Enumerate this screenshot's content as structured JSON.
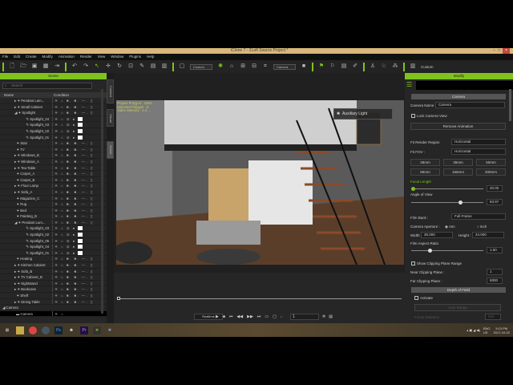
{
  "window": {
    "title": "iClone 7 - 2Loft Source Project *"
  },
  "menu": [
    "File",
    "Edit",
    "Create",
    "Modify",
    "Animation",
    "Render",
    "View",
    "Window",
    "Plugins",
    "Help"
  ],
  "toolbar": {
    "view_mode": "Custom",
    "camera": "Camera",
    "right_mode": "Custom"
  },
  "scene_panel": {
    "title": "Scene",
    "search_placeholder": "Search",
    "col_name": "Name",
    "col_condition": "Condition",
    "rows": [
      {
        "name": "Pendant Lam...",
        "indent": 2,
        "exp": "▸",
        "light": false
      },
      {
        "name": "Small Cabinet",
        "indent": 2,
        "exp": "▸",
        "light": false
      },
      {
        "name": "Spotlight",
        "indent": 2,
        "exp": "◢",
        "light": false
      },
      {
        "name": "Spotlight_04",
        "indent": 3,
        "exp": "",
        "light": true
      },
      {
        "name": "Spotlight_03",
        "indent": 3,
        "exp": "",
        "light": true
      },
      {
        "name": "Spotlight_02",
        "indent": 3,
        "exp": "",
        "light": true
      },
      {
        "name": "Spotlight_01",
        "indent": 3,
        "exp": "",
        "light": true
      },
      {
        "name": "Stair",
        "indent": 2,
        "exp": "",
        "light": false
      },
      {
        "name": "TV",
        "indent": 2,
        "exp": "",
        "light": false
      },
      {
        "name": "Windows_B",
        "indent": 2,
        "exp": "▸",
        "light": false
      },
      {
        "name": "Windows_A",
        "indent": 2,
        "exp": "▸",
        "light": false
      },
      {
        "name": "Tea Table",
        "indent": 2,
        "exp": "▸",
        "light": false
      },
      {
        "name": "Carpet_A",
        "indent": 2,
        "exp": "",
        "light": false
      },
      {
        "name": "Carpet_B",
        "indent": 2,
        "exp": "",
        "light": false
      },
      {
        "name": "Floor Lamp",
        "indent": 2,
        "exp": "▸",
        "light": false
      },
      {
        "name": "Sofa_A",
        "indent": 2,
        "exp": "▸",
        "light": false
      },
      {
        "name": "Magazine_C",
        "indent": 2,
        "exp": "",
        "light": false
      },
      {
        "name": "Rug",
        "indent": 2,
        "exp": "",
        "light": false
      },
      {
        "name": "Bed",
        "indent": 2,
        "exp": "",
        "light": false
      },
      {
        "name": "Painting_B",
        "indent": 2,
        "exp": "",
        "light": false
      },
      {
        "name": "Pendant Lum...",
        "indent": 2,
        "exp": "◢",
        "light": false
      },
      {
        "name": "Spotlight_03",
        "indent": 3,
        "exp": "",
        "light": true
      },
      {
        "name": "Spotlight_02",
        "indent": 3,
        "exp": "",
        "light": true
      },
      {
        "name": "Spotlight_05",
        "indent": 3,
        "exp": "",
        "light": true
      },
      {
        "name": "Spotlight_04",
        "indent": 3,
        "exp": "",
        "light": true
      },
      {
        "name": "Spotlight_01",
        "indent": 3,
        "exp": "",
        "light": true
      },
      {
        "name": "Heating",
        "indent": 2,
        "exp": "",
        "light": false
      },
      {
        "name": "Kitchen Cabinet",
        "indent": 2,
        "exp": "▸",
        "light": false
      },
      {
        "name": "Sofa_B",
        "indent": 2,
        "exp": "▸",
        "light": false
      },
      {
        "name": "TV Cabinet_B",
        "indent": 2,
        "exp": "▸",
        "light": false
      },
      {
        "name": "Nightstand",
        "indent": 2,
        "exp": "▸",
        "light": false
      },
      {
        "name": "Bookcase",
        "indent": 2,
        "exp": "▸",
        "light": false
      },
      {
        "name": "Shelf",
        "indent": 2,
        "exp": "",
        "light": false
      },
      {
        "name": "Dining Table",
        "indent": 2,
        "exp": "▸",
        "light": false
      }
    ],
    "camera_group": "Camera",
    "camera_item": "Camera"
  },
  "side_tabs": [
    "Content",
    "Visual",
    "Scene"
  ],
  "viewport": {
    "stats": [
      "Project Polygon : 1154...",
      "Selected Polygon : 0",
      "Video Memory : 1.4 ..."
    ],
    "aux_light": "Auxiliary Light"
  },
  "timeline": {
    "realtime": "Realtime",
    "frame": "1"
  },
  "modify": {
    "title": "Modify",
    "section_camera": "Camera",
    "camera_name_label": "Camera Name :",
    "camera_name": "Camera",
    "lock_view": "Lock Camera View",
    "remove_animation": "Remove Animation",
    "fit_render_label": "Fit Render Region",
    "fit_render": "Horizontal",
    "fit_fov_label": "Fit FOV :",
    "fit_fov": "Horizontal",
    "lens": [
      "28mm",
      "35mm",
      "50mm",
      "85mm",
      "165mm",
      "200mm"
    ],
    "focal_label": "Focal Length",
    "focal": "20.00",
    "focal_pct": 2,
    "aov_label": "Angle of View",
    "aov": "83.97",
    "aov_pct": 68,
    "film_back_label": "Film Back :",
    "film_back": "Full-Frame",
    "aperture_label": "Camera Aperture :",
    "mm": "mm",
    "inch": "inch",
    "width_label": "Width :",
    "width": "35.000",
    "height_label": "Height :",
    "height": "24.000",
    "aspect_label": "Film Aspect Ratio",
    "aspect": "1.50",
    "aspect_pct": 25,
    "clip_range": "Show Clipping Plane Range",
    "near_label": "Near Clipping Plane :",
    "near": "1",
    "far_label": "Far Clipping Plane :",
    "far": "5000",
    "section_dof": "Depth of Field",
    "activate": "Activate",
    "dof_range": "Auto Range",
    "focus_distance": "Focus Distance",
    "focus_value": "500"
  },
  "taskbar": {
    "lang": "ENG",
    "region": "US",
    "time": "5:13 PM",
    "date": "2017-10-22"
  },
  "colors": {
    "accent": "#7fc31c",
    "title_bar": "#d8b77a",
    "stats_text": "#c8d05a"
  }
}
